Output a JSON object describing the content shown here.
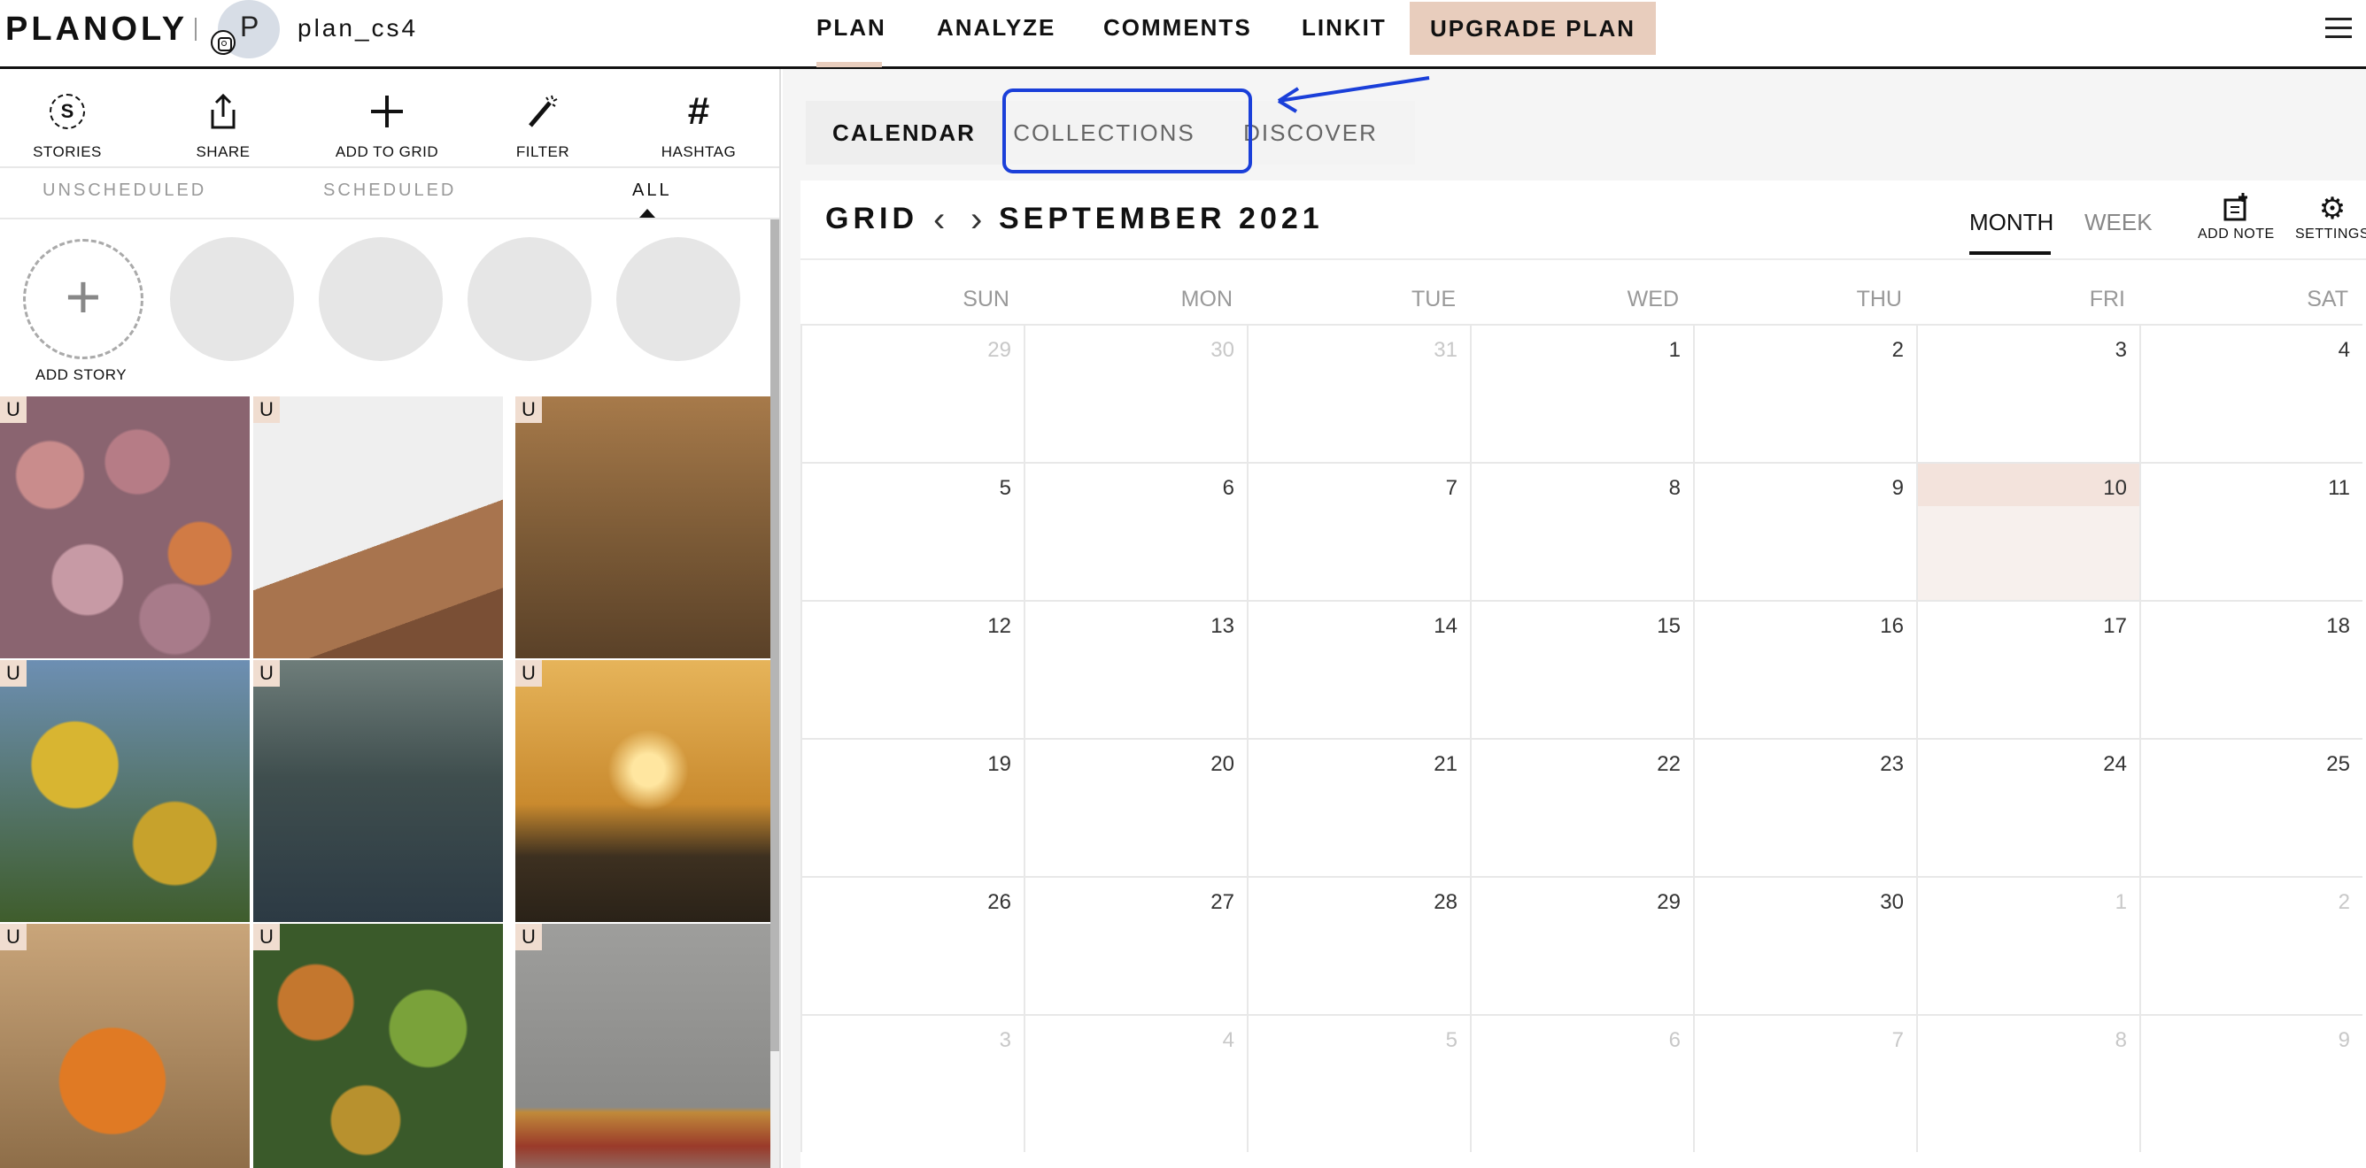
{
  "header": {
    "logo": "PLANOLY",
    "avatar_letter": "P",
    "account": "plan_cs4",
    "nav": [
      "PLAN",
      "ANALYZE",
      "COMMENTS",
      "LINKIT"
    ],
    "upgrade": "UPGRADE PLAN",
    "accent_color": "#e8cdbd"
  },
  "left": {
    "tools": [
      {
        "label": "STORIES",
        "icon": "stories-icon"
      },
      {
        "label": "SHARE",
        "icon": "share-icon"
      },
      {
        "label": "ADD TO GRID",
        "icon": "plus-icon"
      },
      {
        "label": "FILTER",
        "icon": "magic-wand-icon"
      },
      {
        "label": "HASHTAG",
        "icon": "hashtag-icon"
      }
    ],
    "filters": [
      "UNSCHEDULED",
      "SCHEDULED",
      "ALL"
    ],
    "active_filter": "ALL",
    "add_story": "ADD STORY",
    "badge": "U"
  },
  "right": {
    "tabs": [
      "CALENDAR",
      "COLLECTIONS",
      "DISCOVER"
    ],
    "active_tab": "CALENDAR",
    "highlighted_tab": "COLLECTIONS",
    "highlight_color": "#1a3fd9",
    "grid_label": "GRID",
    "month_title": "SEPTEMBER 2021",
    "modes": [
      "MONTH",
      "WEEK"
    ],
    "active_mode": "MONTH",
    "add_note": "ADD NOTE",
    "settings": "SETTINGS",
    "weekdays": [
      "SUN",
      "MON",
      "TUE",
      "WED",
      "THU",
      "FRI",
      "SAT"
    ],
    "weeks": [
      [
        "29",
        "30",
        "31",
        "1",
        "2",
        "3",
        "4"
      ],
      [
        "5",
        "6",
        "7",
        "8",
        "9",
        "10",
        "11"
      ],
      [
        "12",
        "13",
        "14",
        "15",
        "16",
        "17",
        "18"
      ],
      [
        "19",
        "20",
        "21",
        "22",
        "23",
        "24",
        "25"
      ],
      [
        "26",
        "27",
        "28",
        "29",
        "30",
        "1",
        "2"
      ],
      [
        "3",
        "4",
        "5",
        "6",
        "7",
        "8",
        "9"
      ]
    ],
    "today": "10"
  }
}
